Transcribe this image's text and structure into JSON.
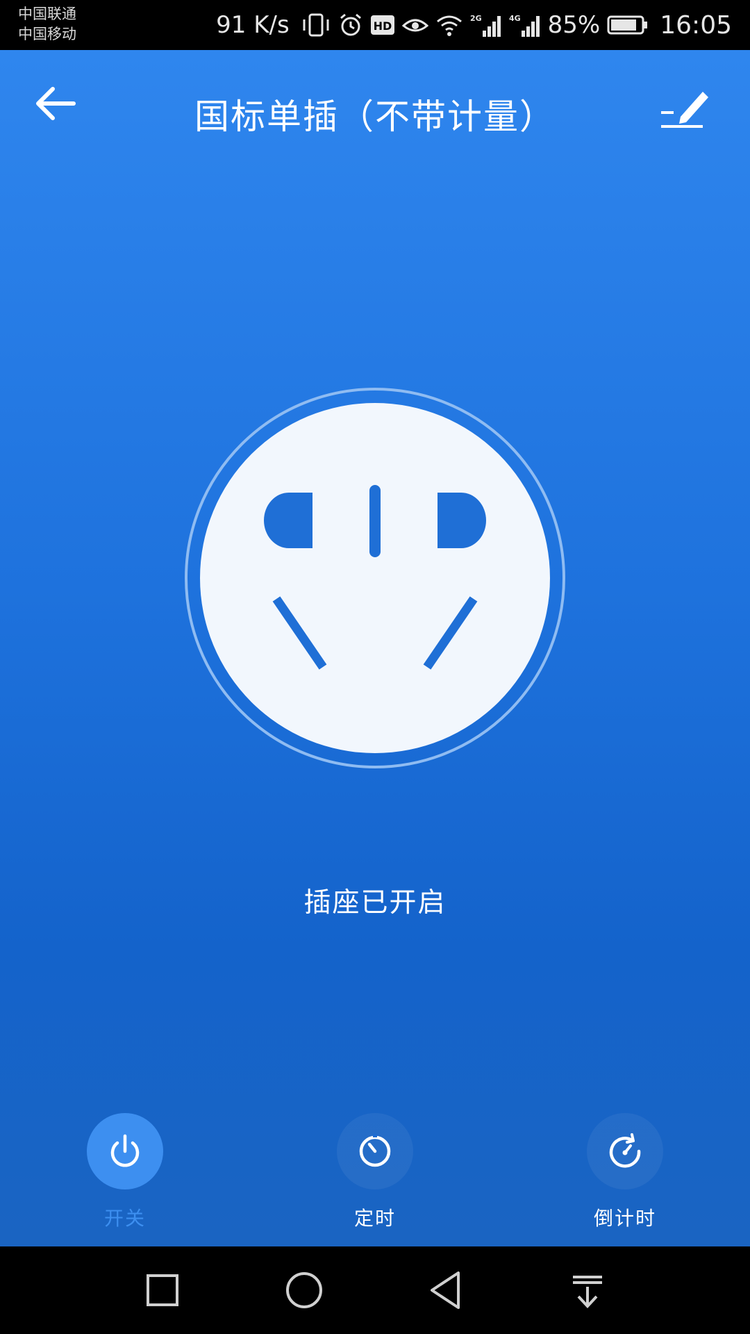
{
  "status_bar": {
    "carrier_1": "中国联通",
    "carrier_2": "中国移动",
    "net_speed": "91 K/s",
    "battery_percent": "85%",
    "time": "16:05",
    "icons": [
      "vibrate-icon",
      "alarm-icon",
      "hd-icon",
      "eye-comfort-icon",
      "wifi-icon",
      "signal-2g-icon",
      "signal-4g-icon",
      "battery-icon"
    ]
  },
  "header": {
    "title": "国标单插（不带计量）",
    "back_icon": "arrow-left-icon",
    "edit_icon": "edit-pencil-icon"
  },
  "socket": {
    "icon": "socket-outlet-icon",
    "status": "插座已开启",
    "colors": {
      "socket_face": "#f2f7fd",
      "accent": "#1f6fd6",
      "ring": "#8fbcf2"
    }
  },
  "actions": [
    {
      "label": "开关",
      "icon": "power-icon",
      "active": true
    },
    {
      "label": "定时",
      "icon": "timer-icon",
      "active": false
    },
    {
      "label": "倒计时",
      "icon": "countdown-icon",
      "active": false
    }
  ],
  "nav_bar": [
    "recent-apps-icon",
    "home-icon",
    "back-triangle-icon",
    "notification-pulldown-icon"
  ],
  "colors": {
    "accent": "#3d8ff0",
    "background_top": "#2f86ee",
    "background_bottom": "#1463cb"
  }
}
